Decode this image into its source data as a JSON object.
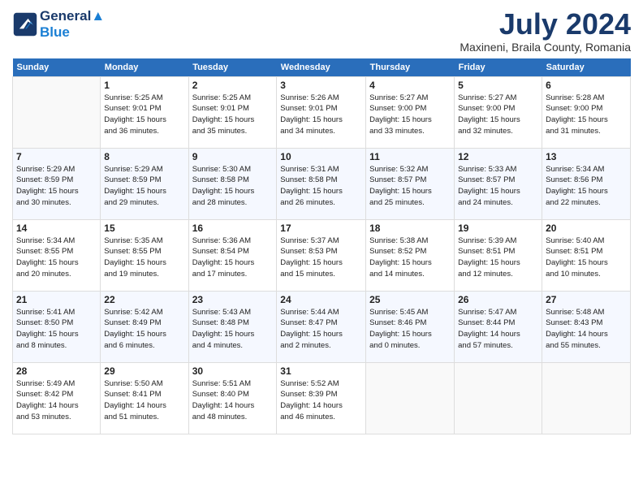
{
  "header": {
    "logo_line1": "General",
    "logo_line2": "Blue",
    "month": "July 2024",
    "location": "Maxineni, Braila County, Romania"
  },
  "days": [
    "Sunday",
    "Monday",
    "Tuesday",
    "Wednesday",
    "Thursday",
    "Friday",
    "Saturday"
  ],
  "weeks": [
    [
      {
        "date": "",
        "info": ""
      },
      {
        "date": "1",
        "info": "Sunrise: 5:25 AM\nSunset: 9:01 PM\nDaylight: 15 hours\nand 36 minutes."
      },
      {
        "date": "2",
        "info": "Sunrise: 5:25 AM\nSunset: 9:01 PM\nDaylight: 15 hours\nand 35 minutes."
      },
      {
        "date": "3",
        "info": "Sunrise: 5:26 AM\nSunset: 9:01 PM\nDaylight: 15 hours\nand 34 minutes."
      },
      {
        "date": "4",
        "info": "Sunrise: 5:27 AM\nSunset: 9:00 PM\nDaylight: 15 hours\nand 33 minutes."
      },
      {
        "date": "5",
        "info": "Sunrise: 5:27 AM\nSunset: 9:00 PM\nDaylight: 15 hours\nand 32 minutes."
      },
      {
        "date": "6",
        "info": "Sunrise: 5:28 AM\nSunset: 9:00 PM\nDaylight: 15 hours\nand 31 minutes."
      }
    ],
    [
      {
        "date": "7",
        "info": "Sunrise: 5:29 AM\nSunset: 8:59 PM\nDaylight: 15 hours\nand 30 minutes."
      },
      {
        "date": "8",
        "info": "Sunrise: 5:29 AM\nSunset: 8:59 PM\nDaylight: 15 hours\nand 29 minutes."
      },
      {
        "date": "9",
        "info": "Sunrise: 5:30 AM\nSunset: 8:58 PM\nDaylight: 15 hours\nand 28 minutes."
      },
      {
        "date": "10",
        "info": "Sunrise: 5:31 AM\nSunset: 8:58 PM\nDaylight: 15 hours\nand 26 minutes."
      },
      {
        "date": "11",
        "info": "Sunrise: 5:32 AM\nSunset: 8:57 PM\nDaylight: 15 hours\nand 25 minutes."
      },
      {
        "date": "12",
        "info": "Sunrise: 5:33 AM\nSunset: 8:57 PM\nDaylight: 15 hours\nand 24 minutes."
      },
      {
        "date": "13",
        "info": "Sunrise: 5:34 AM\nSunset: 8:56 PM\nDaylight: 15 hours\nand 22 minutes."
      }
    ],
    [
      {
        "date": "14",
        "info": "Sunrise: 5:34 AM\nSunset: 8:55 PM\nDaylight: 15 hours\nand 20 minutes."
      },
      {
        "date": "15",
        "info": "Sunrise: 5:35 AM\nSunset: 8:55 PM\nDaylight: 15 hours\nand 19 minutes."
      },
      {
        "date": "16",
        "info": "Sunrise: 5:36 AM\nSunset: 8:54 PM\nDaylight: 15 hours\nand 17 minutes."
      },
      {
        "date": "17",
        "info": "Sunrise: 5:37 AM\nSunset: 8:53 PM\nDaylight: 15 hours\nand 15 minutes."
      },
      {
        "date": "18",
        "info": "Sunrise: 5:38 AM\nSunset: 8:52 PM\nDaylight: 15 hours\nand 14 minutes."
      },
      {
        "date": "19",
        "info": "Sunrise: 5:39 AM\nSunset: 8:51 PM\nDaylight: 15 hours\nand 12 minutes."
      },
      {
        "date": "20",
        "info": "Sunrise: 5:40 AM\nSunset: 8:51 PM\nDaylight: 15 hours\nand 10 minutes."
      }
    ],
    [
      {
        "date": "21",
        "info": "Sunrise: 5:41 AM\nSunset: 8:50 PM\nDaylight: 15 hours\nand 8 minutes."
      },
      {
        "date": "22",
        "info": "Sunrise: 5:42 AM\nSunset: 8:49 PM\nDaylight: 15 hours\nand 6 minutes."
      },
      {
        "date": "23",
        "info": "Sunrise: 5:43 AM\nSunset: 8:48 PM\nDaylight: 15 hours\nand 4 minutes."
      },
      {
        "date": "24",
        "info": "Sunrise: 5:44 AM\nSunset: 8:47 PM\nDaylight: 15 hours\nand 2 minutes."
      },
      {
        "date": "25",
        "info": "Sunrise: 5:45 AM\nSunset: 8:46 PM\nDaylight: 15 hours\nand 0 minutes."
      },
      {
        "date": "26",
        "info": "Sunrise: 5:47 AM\nSunset: 8:44 PM\nDaylight: 14 hours\nand 57 minutes."
      },
      {
        "date": "27",
        "info": "Sunrise: 5:48 AM\nSunset: 8:43 PM\nDaylight: 14 hours\nand 55 minutes."
      }
    ],
    [
      {
        "date": "28",
        "info": "Sunrise: 5:49 AM\nSunset: 8:42 PM\nDaylight: 14 hours\nand 53 minutes."
      },
      {
        "date": "29",
        "info": "Sunrise: 5:50 AM\nSunset: 8:41 PM\nDaylight: 14 hours\nand 51 minutes."
      },
      {
        "date": "30",
        "info": "Sunrise: 5:51 AM\nSunset: 8:40 PM\nDaylight: 14 hours\nand 48 minutes."
      },
      {
        "date": "31",
        "info": "Sunrise: 5:52 AM\nSunset: 8:39 PM\nDaylight: 14 hours\nand 46 minutes."
      },
      {
        "date": "",
        "info": ""
      },
      {
        "date": "",
        "info": ""
      },
      {
        "date": "",
        "info": ""
      }
    ]
  ]
}
